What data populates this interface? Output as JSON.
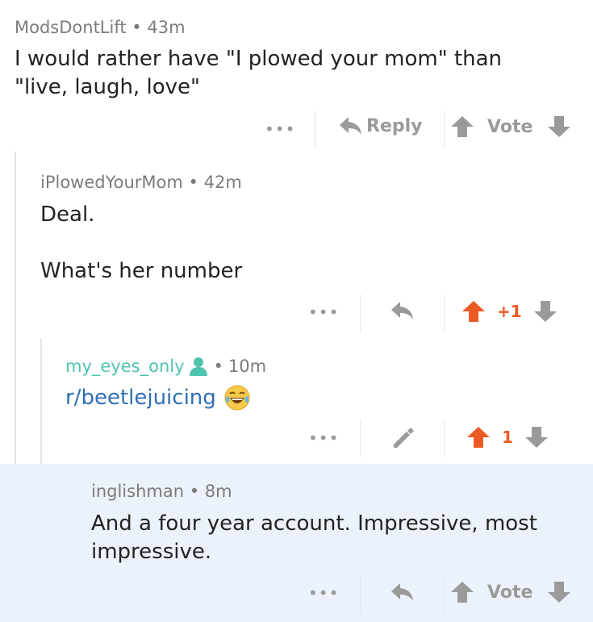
{
  "colors": {
    "upvoted": "#ec5a24",
    "mod_user": "#4ec4b0",
    "link": "#2f6fb5",
    "highlight_bg": "#ecf2fb"
  },
  "comments": [
    {
      "author": "ModsDontLift",
      "time": "43m",
      "body": "I would rather have \"I plowed your mom\" than \"live, laugh, love\"",
      "reply_label": "Reply",
      "vote_label": "Vote"
    },
    {
      "author": "iPlowedYourMom",
      "time": "42m",
      "body_line1": "Deal.",
      "body_line2": "What's her number",
      "score": "+1"
    },
    {
      "author": "my_eyes_only",
      "time": "10m",
      "body": "r/beetlejuicing",
      "score": "1"
    },
    {
      "author": "inglishman",
      "time": "8m",
      "body": "And a four year account. Impressive, most impressive.",
      "vote_label": "Vote"
    }
  ],
  "separator": "•",
  "more_dots": "•••"
}
